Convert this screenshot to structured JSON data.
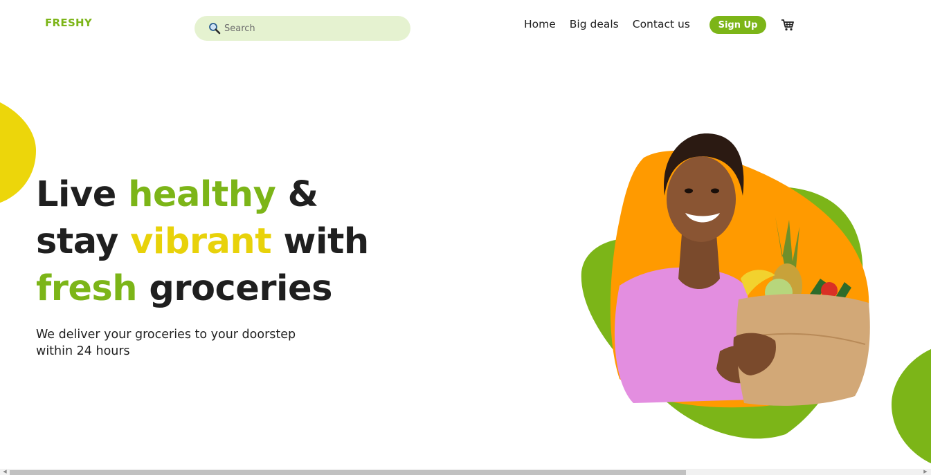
{
  "header": {
    "logo": "FRESHY",
    "search": {
      "placeholder": "Search",
      "icon": "search-icon"
    },
    "nav": [
      {
        "label": "Home"
      },
      {
        "label": "Big deals"
      },
      {
        "label": "Contact us"
      }
    ],
    "signup_label": "Sign Up",
    "cart_icon": "cart-icon"
  },
  "hero": {
    "headline": {
      "line1": {
        "w1": "Live",
        "w2": "healthy",
        "w3": "&"
      },
      "line2": {
        "w1": "stay",
        "w2": "vibrant",
        "w3": "with"
      },
      "line3": {
        "w1": "fresh",
        "w2": "groceries"
      }
    },
    "subtext_line1": "We deliver your groceries to your doorstep",
    "subtext_line2": "within 24 hours"
  },
  "colors": {
    "brand_green": "#7cb518",
    "accent_yellow": "#e8d20a",
    "accent_orange": "#ff9800",
    "search_bg": "#e5f2d0",
    "text": "#1f1f1f"
  }
}
